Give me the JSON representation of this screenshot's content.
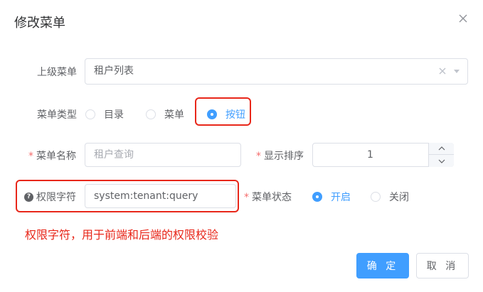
{
  "dialog": {
    "title": "修改菜单",
    "close_icon": "close-icon"
  },
  "form": {
    "parent_menu": {
      "label": "上级菜单",
      "value": "租户列表"
    },
    "menu_type": {
      "label": "菜单类型",
      "options": [
        "目录",
        "菜单",
        "按钮"
      ],
      "selected": "按钮"
    },
    "menu_name": {
      "required_mark": "*",
      "label": "菜单名称",
      "placeholder": "租户查询"
    },
    "display_order": {
      "required_mark": "*",
      "label": "显示排序",
      "value": "1"
    },
    "permission": {
      "label": "权限字符",
      "value": "system:tenant:query"
    },
    "menu_status": {
      "required_mark": "*",
      "label": "菜单状态",
      "options": [
        "开启",
        "关闭"
      ],
      "selected": "开启"
    }
  },
  "annotation": "权限字符，用于前端和后端的权限校验",
  "footer": {
    "confirm_label": "确 定",
    "cancel_label": "取 消"
  },
  "colors": {
    "accent": "#409eff",
    "annotation_red": "#e8271a",
    "required": "#f56c6c"
  }
}
